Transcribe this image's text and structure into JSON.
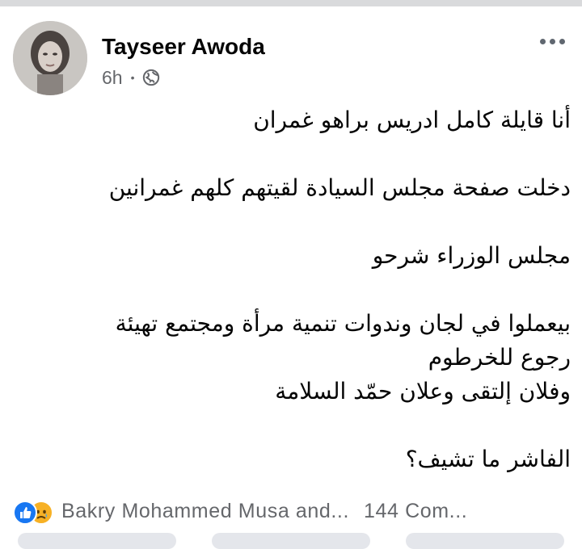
{
  "post": {
    "author": "Tayseer Awoda",
    "time": "6h",
    "separator": "•",
    "audience_icon": "globe-icon",
    "menu_icon": "more-horizontal-icon",
    "avatar_alt": "profile photo"
  },
  "body": {
    "paragraphs": [
      [
        "أنا قايلة كامل ادريس براهو غمران"
      ],
      [
        "دخلت صفحة مجلس السيادة لقيتهم كلهم غمرانين"
      ],
      [
        "مجلس الوزراء شرحو"
      ],
      [
        "بيعملوا في لجان وندوات تنمية مرأة ومجتمع تهيئة",
        "رجوع للخرطوم",
        "وفلان إلتقى وعلان حمّد السلامة"
      ],
      [
        "الفاشر ما تشيف؟"
      ]
    ]
  },
  "footer": {
    "reactions": [
      "like-icon",
      "sad-icon"
    ],
    "reactors": "Bakry Mohammed Musa and...",
    "comments": "144 Com..."
  },
  "colors": {
    "text": "#050505",
    "meta": "#65676b",
    "like": "#1877f2",
    "sad": "#f7b125",
    "divider": "#d9dadc"
  }
}
